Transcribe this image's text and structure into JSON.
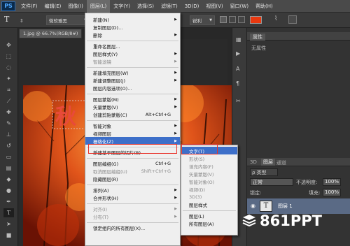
{
  "app_logo": "PS",
  "menubar": {
    "items": [
      "文件(F)",
      "编辑(E)",
      "图像(I)",
      "图层(L)",
      "文字(Y)",
      "选择(S)",
      "滤镜(T)",
      "3D(D)",
      "视图(V)",
      "窗口(W)",
      "帮助(H)"
    ]
  },
  "options": {
    "font_family": "微软雅黑",
    "antialias": "锐利",
    "text_tool_glyph": "T"
  },
  "document": {
    "tab_label": "1.jpg @ 66.7%(RGB/8#)",
    "text_overlay": "秋"
  },
  "properties_panel": {
    "tab": "属性",
    "content": "无属性"
  },
  "layers_panel": {
    "tabs": [
      "3D",
      "图层",
      "通道"
    ],
    "filter_label": "ρ 类型",
    "blend_mode": "正常",
    "opacity_label": "不透明度:",
    "opacity_value": "100%",
    "lock_label": "锁定:",
    "fill_label": "填充:",
    "fill_value": "100%",
    "layers": [
      {
        "name": "图层 1",
        "thumb": "T"
      }
    ]
  },
  "layer_menu": {
    "items": [
      {
        "label": "新建(N)",
        "submenu": true
      },
      {
        "label": "复制图层(D)..."
      },
      {
        "label": "删除",
        "submenu": true
      },
      {
        "sep": true
      },
      {
        "label": "重命名图层..."
      },
      {
        "label": "图层样式(Y)",
        "submenu": true
      },
      {
        "label": "智能滤镜",
        "submenu": true,
        "disabled": true
      },
      {
        "sep": true
      },
      {
        "label": "新建填充图层(W)",
        "submenu": true
      },
      {
        "label": "新建调整图层(J)",
        "submenu": true
      },
      {
        "label": "图层内容选项(O)..."
      },
      {
        "sep": true
      },
      {
        "label": "图层蒙版(M)",
        "submenu": true
      },
      {
        "label": "矢量蒙版(V)",
        "submenu": true
      },
      {
        "label": "创建剪贴蒙版(C)",
        "shortcut": "Alt+Ctrl+G"
      },
      {
        "sep": true
      },
      {
        "label": "智能对象",
        "submenu": true
      },
      {
        "label": "视频图层",
        "submenu": true
      },
      {
        "label": "栅格化(Z)",
        "submenu": true,
        "highlighted": true
      },
      {
        "sep": true
      },
      {
        "label": "新建基于图层的切片(B)"
      },
      {
        "sep": true
      },
      {
        "label": "图层编组(G)",
        "shortcut": "Ctrl+G"
      },
      {
        "label": "取消图层编组(U)",
        "shortcut": "Shift+Ctrl+G",
        "disabled": true
      },
      {
        "label": "隐藏图层(R)"
      },
      {
        "sep": true
      },
      {
        "label": "排列(A)",
        "submenu": true
      },
      {
        "label": "合并形状(H)",
        "submenu": true
      },
      {
        "sep": true
      },
      {
        "label": "对齐(I)",
        "submenu": true,
        "disabled": true
      },
      {
        "label": "分布(T)",
        "submenu": true,
        "disabled": true
      },
      {
        "sep": true
      },
      {
        "label": "锁定组内的所有图层(X)..."
      }
    ]
  },
  "rasterize_submenu": {
    "items": [
      {
        "label": "文字(T)",
        "highlighted": true
      },
      {
        "label": "形状(S)",
        "disabled": true
      },
      {
        "label": "填充内容(F)",
        "disabled": true
      },
      {
        "label": "矢量蒙版(V)",
        "disabled": true
      },
      {
        "label": "智能对象(O)",
        "disabled": true
      },
      {
        "label": "视频(D)",
        "disabled": true
      },
      {
        "label": "3D(3)",
        "disabled": true
      },
      {
        "label": "图层样式"
      },
      {
        "sep": true
      },
      {
        "label": "图层(L)"
      },
      {
        "label": "所有图层(A)"
      }
    ]
  },
  "watermark": "861PPT",
  "colors": {
    "accent_highlight": "#3d6fc9",
    "callout_red": "#e8322a",
    "foreground_swatch": "#e8380f"
  }
}
